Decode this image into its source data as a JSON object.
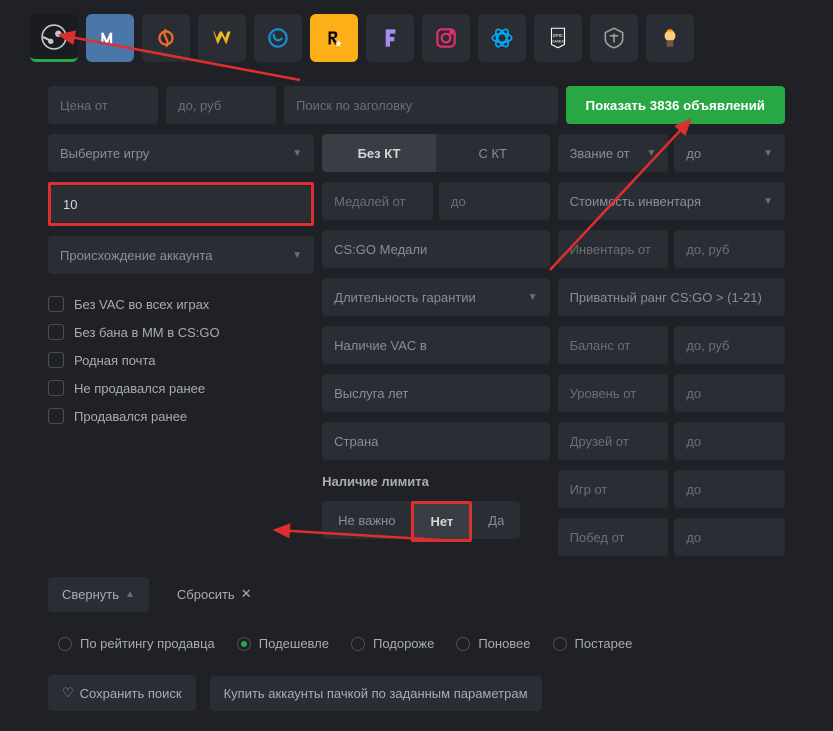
{
  "platforms": [
    "steam",
    "vk",
    "origin",
    "warface",
    "uplay",
    "rockstar",
    "fortnite",
    "instagram",
    "battlenet",
    "epic",
    "wot",
    "coc"
  ],
  "price": {
    "from": "Цена от",
    "to": "до, руб"
  },
  "search": {
    "placeholder": "Поиск по заголовку"
  },
  "cta": "Показать 3836 объявлений",
  "left": {
    "game_select": "Выберите игру",
    "input_value": "10",
    "origin": "Происхождение аккаунта",
    "checks": [
      "Без VAC во всех играх",
      "Без бана в ММ в CS:GO",
      "Родная почта",
      "Не продавался ранее",
      "Продавался ранее"
    ]
  },
  "mid": {
    "kt": {
      "no": "Без КТ",
      "yes": "С КТ"
    },
    "medals_from": "Медалей от",
    "medals_to": "до",
    "csgo_medals": "CS:GO Медали",
    "warranty": "Длительность гарантии",
    "vac_in": "Наличие VAC в",
    "service": "Выслуга лет",
    "country": "Страна",
    "limit_label": "Наличие лимита",
    "limit": {
      "any": "Не важно",
      "no": "Нет",
      "yes": "Да"
    }
  },
  "right": {
    "rank_from": "Звание от",
    "rank_to": "до",
    "inv_cost": "Стоимость инвентаря",
    "inv_from": "Инвентарь от",
    "inv_to": "до, руб",
    "private_rank": "Приватный ранг CS:GO > (1-21)",
    "balance_from": "Баланс от",
    "balance_to": "до, руб",
    "level_from": "Уровень от",
    "level_to": "до",
    "friends_from": "Друзей от",
    "friends_to": "до",
    "games_from": "Игр от",
    "games_to": "до",
    "wins_from": "Побед от",
    "wins_to": "до"
  },
  "collapse": "Свернуть",
  "reset": "Сбросить",
  "sort": {
    "rating": "По рейтингу продавца",
    "cheap": "Подешевле",
    "expensive": "Подороже",
    "new": "Поновее",
    "old": "Постарее"
  },
  "save": "Сохранить поиск",
  "bulk": "Купить аккаунты пачкой по заданным параметрам"
}
